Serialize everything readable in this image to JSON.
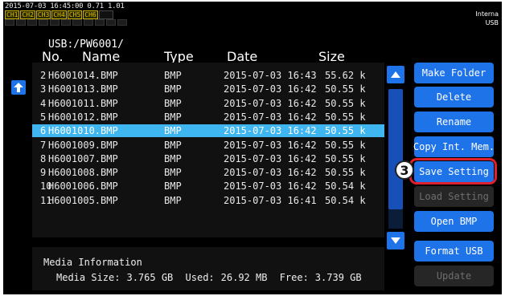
{
  "status": {
    "datetime": "2015-07-03 16:45:00",
    "version": "0.71 1.01",
    "channels": [
      "CH1",
      "CH2",
      "CH3",
      "CH4",
      "CH5",
      "CH6"
    ],
    "channels_active": [
      true,
      true,
      true,
      true,
      true,
      true
    ],
    "storage": [
      "Interna",
      "USB"
    ]
  },
  "path": "USB:/PW6001/",
  "columns": {
    "no": "No.",
    "name": "Name",
    "type": "Type",
    "date": "Date",
    "size": "Size"
  },
  "files": [
    {
      "no": "2",
      "name": "H6001014.BMP",
      "type": "BMP",
      "date": "2015-07-03 16:43",
      "size": "55.62 k",
      "selected": false
    },
    {
      "no": "3",
      "name": "H6001013.BMP",
      "type": "BMP",
      "date": "2015-07-03 16:42",
      "size": "50.55 k",
      "selected": false
    },
    {
      "no": "4",
      "name": "H6001011.BMP",
      "type": "BMP",
      "date": "2015-07-03 16:42",
      "size": "50.55 k",
      "selected": false
    },
    {
      "no": "5",
      "name": "H6001012.BMP",
      "type": "BMP",
      "date": "2015-07-03 16:42",
      "size": "50.55 k",
      "selected": false
    },
    {
      "no": "6",
      "name": "H6001010.BMP",
      "type": "BMP",
      "date": "2015-07-03 16:42",
      "size": "50.55 k",
      "selected": true
    },
    {
      "no": "7",
      "name": "H6001009.BMP",
      "type": "BMP",
      "date": "2015-07-03 16:42",
      "size": "50.55 k",
      "selected": false
    },
    {
      "no": "8",
      "name": "H6001007.BMP",
      "type": "BMP",
      "date": "2015-07-03 16:42",
      "size": "50.55 k",
      "selected": false
    },
    {
      "no": "9",
      "name": "H6001008.BMP",
      "type": "BMP",
      "date": "2015-07-03 16:42",
      "size": "50.55 k",
      "selected": false
    },
    {
      "no": "10",
      "name": "H6001006.BMP",
      "type": "BMP",
      "date": "2015-07-03 16:42",
      "size": "50.54 k",
      "selected": false
    },
    {
      "no": "11",
      "name": "H6001005.BMP",
      "type": "BMP",
      "date": "2015-07-03 16:41",
      "size": "50.54 k",
      "selected": false
    }
  ],
  "buttons": {
    "make_folder": "Make Folder",
    "delete": "Delete",
    "rename": "Rename",
    "copy_int_mem": "Copy Int. Mem.",
    "save_setting": "Save Setting",
    "load_setting": "Load Setting",
    "open_bmp": "Open BMP",
    "format_usb": "Format USB",
    "update": "Update"
  },
  "callout": "3",
  "media": {
    "title": "Media Information",
    "size_label": "Media Size:",
    "size_value": "3.765 GB",
    "used_label": "Used:",
    "used_value": "26.92 MB",
    "free_label": "Free:",
    "free_value": "3.739 GB"
  },
  "icons": {
    "up": "up-arrow-icon",
    "scroll_up": "triangle-up-icon",
    "scroll_down": "triangle-down-icon"
  },
  "colors": {
    "accent": "#1e73e8",
    "selected_row": "#3fb6f0",
    "highlight": "#e0202c",
    "channel": "#e0c000"
  }
}
